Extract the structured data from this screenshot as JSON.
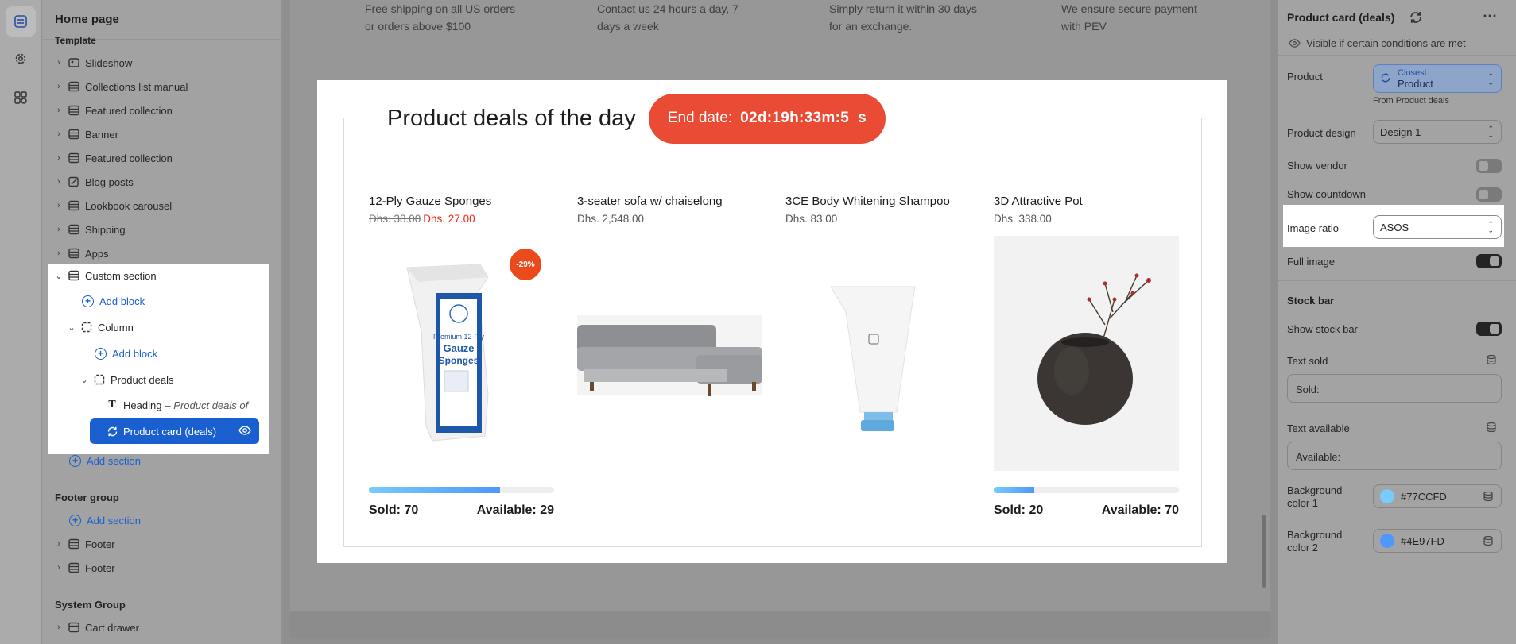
{
  "sidebar": {
    "title": "Home page",
    "template_label": "Template",
    "items": [
      "Slideshow",
      "Collections list manual",
      "Featured collection",
      "Banner",
      "Featured collection",
      "Blog posts",
      "Lookbook carousel",
      "Shipping",
      "Apps"
    ],
    "custom_section": "Custom section",
    "add_block": "Add block",
    "column": "Column",
    "product_deals": "Product deals",
    "heading_label": "Heading",
    "heading_sub": "– Product deals of",
    "selected_item": "Product card (deals)",
    "add_section": "Add section",
    "footer_group": "Footer group",
    "footer_items": [
      "Footer",
      "Footer"
    ],
    "system_group": "System Group",
    "system_items": [
      "Cart drawer"
    ]
  },
  "canvas": {
    "info": [
      {
        "line1": "Free shipping on all US orders",
        "line2": "or orders above $100"
      },
      {
        "line1": "Contact us 24 hours a day, 7",
        "line2": "days a week"
      },
      {
        "line1": "Simply return it within 30 days",
        "line2": "for an exchange."
      },
      {
        "line1": "We ensure secure payment",
        "line2": "with PEV"
      }
    ],
    "deals_title": "Product deals of the day",
    "end_date_label": "End date:",
    "countdown": "02d:19h:33m:5  s",
    "products": [
      {
        "name": "12-Ply Gauze Sponges",
        "old_price": "Dhs. 38.00",
        "price": "Dhs. 27.00",
        "badge": "-29%",
        "sold": "Sold: 70",
        "available": "Available: 29",
        "progress": 0.71
      },
      {
        "name": "3-seater sofa w/ chaiselong",
        "price": "Dhs. 2,548.00"
      },
      {
        "name": "3CE Body Whitening Shampoo",
        "price": "Dhs. 83.00"
      },
      {
        "name": "3D Attractive Pot",
        "price": "Dhs. 338.00",
        "sold": "Sold: 20",
        "available": "Available: 70",
        "progress": 0.22
      }
    ]
  },
  "panel": {
    "title": "Product card (deals)",
    "visibility": "Visible if certain conditions are met",
    "product_label": "Product",
    "product_source_small": "Closest",
    "product_source": "Product",
    "product_from": "From Product deals",
    "design_label": "Product design",
    "design_value": "Design 1",
    "show_vendor": "Show vendor",
    "show_countdown": "Show countdown",
    "image_ratio_label": "Image ratio",
    "image_ratio_value": "ASOS",
    "full_image": "Full image",
    "stock_heading": "Stock bar",
    "show_stock_bar": "Show stock bar",
    "text_sold_label": "Text sold",
    "text_sold_value": "Sold:",
    "text_available_label": "Text available",
    "text_available_value": "Available:",
    "bg1_label_a": "Background",
    "bg1_label_b": "color 1",
    "bg1_value": "#77CCFD",
    "bg2_label_a": "Background",
    "bg2_label_b": "color 2",
    "bg2_value": "#4E97FD"
  }
}
